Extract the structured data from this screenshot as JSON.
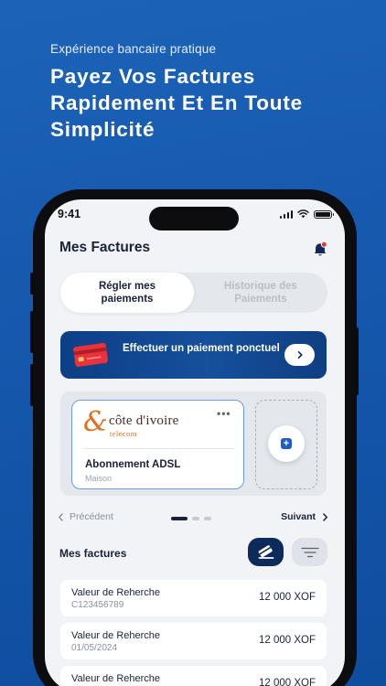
{
  "promo": {
    "subtitle": "Expérience bancaire pratique",
    "title": "Payez Vos Factures Rapidement Et En Toute Simplicité"
  },
  "status_bar": {
    "time": "9:41"
  },
  "header": {
    "title": "Mes Factures"
  },
  "tabs": [
    {
      "label": "Régler mes paiements",
      "active": true
    },
    {
      "label": "Historique des Paiements",
      "active": false
    }
  ],
  "pay_banner": {
    "label": "Effectuer un paiement ponctuel"
  },
  "bill_card": {
    "logo_name": "côte d'ivoire",
    "logo_sub": "telecom",
    "more": "•••",
    "name": "Abonnement ADSL",
    "subtitle": "Maison"
  },
  "pager": {
    "prev": "Précédent",
    "next": "Suivant",
    "page_count": 3,
    "current_page": 1
  },
  "list": {
    "title": "Mes factures",
    "invoices": [
      {
        "name": "Valeur de Reherche",
        "sub": "C123456789",
        "amount": "12 000 XOF"
      },
      {
        "name": "Valeur de Reherche",
        "sub": "01/05/2024",
        "amount": "12 000 XOF"
      },
      {
        "name": "Valeur de Reherche",
        "sub": "",
        "amount": "12 000 XOF"
      }
    ]
  },
  "colors": {
    "background": "#1558ad",
    "banner": "#0c3f86",
    "accent": "#1f5dc0",
    "alert": "#e53935",
    "logo_orange": "#e36f1e"
  },
  "icons": {
    "bell": "bell-icon",
    "arrow": "arrow-right-icon",
    "credit_card": "credit-card-icon",
    "add": "add-icon",
    "pay": "bill-pay-icon",
    "filter": "filter-icon"
  }
}
